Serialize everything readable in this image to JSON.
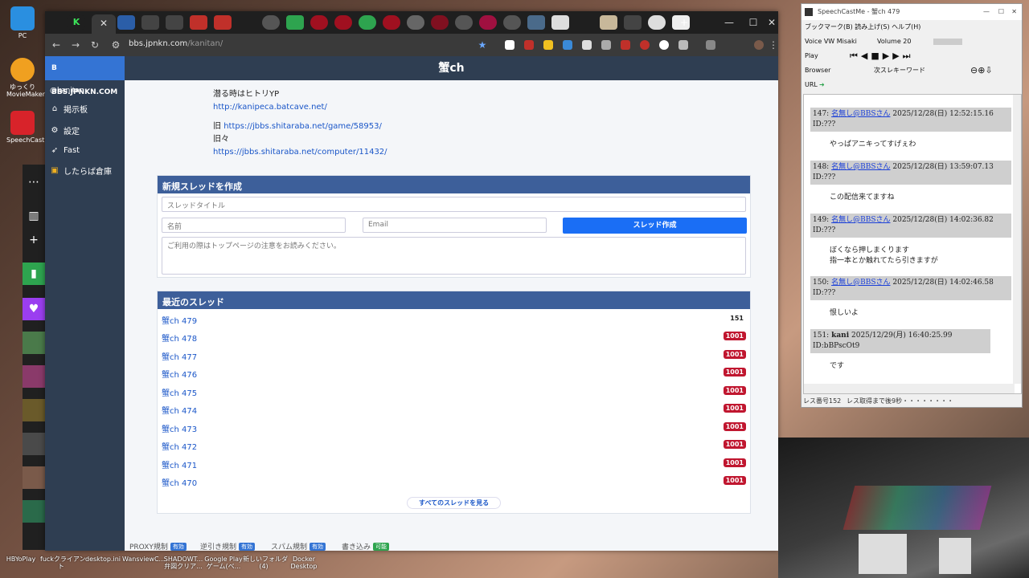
{
  "desktop": {
    "icons": [
      {
        "label": "PC"
      },
      {
        "label": "ゆっくり\nMovieMaker"
      },
      {
        "label": "SpeechCast"
      }
    ],
    "taskbar": [
      {
        "label": "HBYoPlay"
      },
      {
        "label": "fuckクライアン\nト"
      },
      {
        "label": "desktop.ini"
      },
      {
        "label": "WansviewC..."
      },
      {
        "label": "SHADOWT...\n弁図クリア..."
      },
      {
        "label": "Google Play\nゲーム(ベ..."
      },
      {
        "label": "新しいフォルダ\n(4)"
      },
      {
        "label": "Docker\nDesktop"
      }
    ]
  },
  "browser": {
    "url_domain": "bbs.jpnkn.com",
    "url_path": "/kanitan/",
    "close_label": "✕"
  },
  "site": {
    "brand": "BBS.JPNKN.COM",
    "board_title": "蟹ch",
    "user": "@kanitan",
    "nav": [
      {
        "label": "掲示板"
      },
      {
        "label": "設定"
      },
      {
        "label": "Fast"
      },
      {
        "label": "したらば倉庫"
      }
    ]
  },
  "description": {
    "line1": "潜る時はヒトリYP",
    "link1": "http://kanipeca.batcave.net/",
    "old_label": "旧",
    "link2": "https://jbbs.shitaraba.net/game/58953/",
    "older_label": "旧々",
    "link3": "https://jbbs.shitaraba.net/computer/11432/"
  },
  "new_thread": {
    "header": "新規スレッドを作成",
    "title_placeholder": "スレッドタイトル",
    "name_placeholder": "名前",
    "email_placeholder": "Email",
    "submit_label": "スレッド作成",
    "body_placeholder": "ご利用の際はトップページの注意をお読みください。"
  },
  "recent": {
    "header": "最近のスレッド",
    "threads": [
      {
        "title": "蟹ch 479",
        "count": "151"
      },
      {
        "title": "蟹ch 478",
        "count": "1001"
      },
      {
        "title": "蟹ch 477",
        "count": "1001"
      },
      {
        "title": "蟹ch 476",
        "count": "1001"
      },
      {
        "title": "蟹ch 475",
        "count": "1001"
      },
      {
        "title": "蟹ch 474",
        "count": "1001"
      },
      {
        "title": "蟹ch 473",
        "count": "1001"
      },
      {
        "title": "蟹ch 472",
        "count": "1001"
      },
      {
        "title": "蟹ch 471",
        "count": "1001"
      },
      {
        "title": "蟹ch 470",
        "count": "1001"
      }
    ],
    "all_label": "すべてのスレッドを見る"
  },
  "footer": [
    {
      "label": "PROXY規制",
      "badge": "有効"
    },
    {
      "label": "逆引き規制",
      "badge": "有効"
    },
    {
      "label": "スパム規制",
      "badge": "有効"
    },
    {
      "label": "書き込み",
      "badge": "可能"
    }
  ],
  "speechcast": {
    "title": "SpeechCastMe - 蟹ch 479",
    "menu": "ブックマーク(B)   読み上げ(S)   ヘルプ(H)",
    "voice": "Voice  VW Misaki",
    "volume": "Volume  20",
    "play": "Play",
    "browser": "Browser",
    "search": "次スレキーワード",
    "url_label": "URL",
    "posts": [
      {
        "num": "147:",
        "name": "名無し@BBSさん",
        "date": "2025/12/28(日) 12:52:15.16 ID:???",
        "body": "やっぱアニキってすげぇわ"
      },
      {
        "num": "148:",
        "name": "名無し@BBSさん",
        "date": "2025/12/28(日) 13:59:07.13 ID:???",
        "body": "この配信来てますね"
      },
      {
        "num": "149:",
        "name": "名無し@BBSさん",
        "date": "2025/12/28(日) 14:02:36.82 ID:???",
        "body": "ぼくなら押しまくります\n指一本とか触れてたら引きますが"
      },
      {
        "num": "150:",
        "name": "名無し@BBSさん",
        "date": "2025/12/28(日) 14:02:46.58 ID:???",
        "body": "恨しいよ"
      },
      {
        "num": "151:",
        "name": "kani",
        "date": "2025/12/29(月) 16:40:25.99 ID:bBPscOt9",
        "body": "です"
      }
    ],
    "status_left": "レス番号152",
    "status_right": "レス取得まで後9秒・・・・・・・・"
  }
}
